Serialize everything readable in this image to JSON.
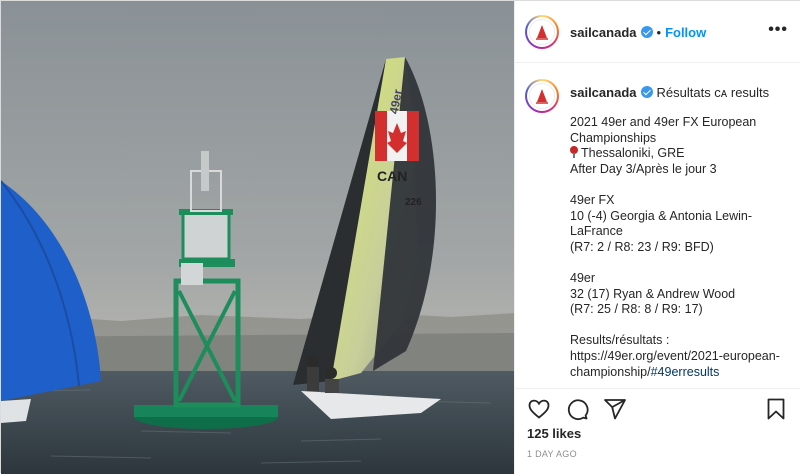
{
  "photo": {
    "alt": "Sailing skiff CAN near navigation buoy",
    "sail_number": "CAN",
    "sail_number_2": "49er",
    "sail_number_side": "226"
  },
  "header": {
    "username": "sailcanada",
    "separator": "•",
    "follow_label": "Follow",
    "more_label": "•••"
  },
  "caption": {
    "username": "sailcanada",
    "intro": "Résultats ᴄᴀ results",
    "lines": [
      "2021 49er and 49er FX European Championships",
      "Thessaloniki, GRE",
      "After Day 3/Après le jour 3",
      "",
      "49er FX",
      "10 (-4) Georgia & Antonia Lewin-LaFrance",
      "(R7: 2 / R8: 23 / R9: BFD)",
      "",
      "49er",
      "32 (17) Ryan & Andrew Wood",
      "(R7: 25 / R8: 8 / R9: 17)",
      "",
      "Results/résultats :",
      "https://49er.org/event/2021-european-championship/"
    ],
    "hashtag": "#49erresults"
  },
  "actions": {
    "likes": "125 likes",
    "timestamp": "1 DAY AGO"
  },
  "colors": {
    "accent": "#0095f6",
    "verified": "#3897f0",
    "text": "#262626",
    "muted": "#8e8e8e"
  },
  "icons": [
    "heart-icon",
    "comment-icon",
    "share-icon",
    "bookmark-icon",
    "verified-icon",
    "location-pin-icon",
    "more-icon"
  ]
}
